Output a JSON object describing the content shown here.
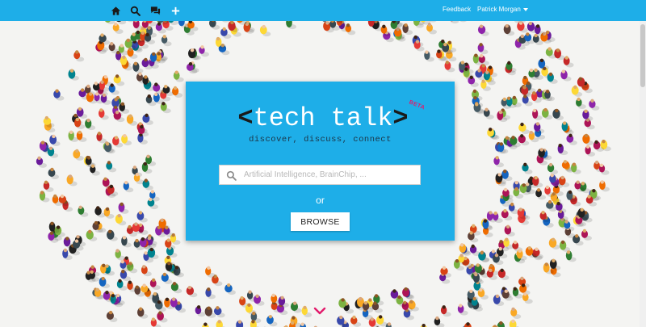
{
  "nav": {
    "icons": [
      "home-icon",
      "search-icon",
      "chat-icon",
      "plus-icon"
    ],
    "feedback": "Feedback",
    "user": "Patrick Morgan",
    "accent": "#1eaee8"
  },
  "hero": {
    "logo_open": "<",
    "logo_text": "tech talk",
    "logo_close": ">",
    "beta": "BETA",
    "tagline": "discover, discuss, connect",
    "search_placeholder": "Artificial Intelligence, BrainChip, ...",
    "search_value": "",
    "or": "or",
    "browse": "BROWSE",
    "beta_color": "#e21a6b"
  },
  "scroll_hint": {
    "icon": "chevron-down-icon",
    "color": "#e21a6b"
  }
}
